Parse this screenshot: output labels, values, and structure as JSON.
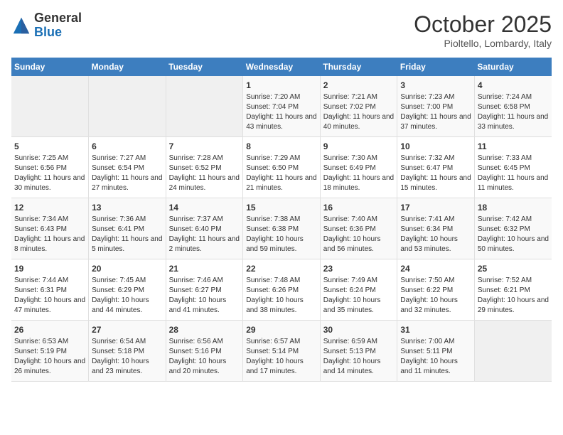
{
  "header": {
    "logo_general": "General",
    "logo_blue": "Blue",
    "month": "October 2025",
    "location": "Pioltello, Lombardy, Italy"
  },
  "days_of_week": [
    "Sunday",
    "Monday",
    "Tuesday",
    "Wednesday",
    "Thursday",
    "Friday",
    "Saturday"
  ],
  "weeks": [
    [
      {
        "day": "",
        "info": ""
      },
      {
        "day": "",
        "info": ""
      },
      {
        "day": "",
        "info": ""
      },
      {
        "day": "1",
        "info": "Sunrise: 7:20 AM\nSunset: 7:04 PM\nDaylight: 11 hours and 43 minutes."
      },
      {
        "day": "2",
        "info": "Sunrise: 7:21 AM\nSunset: 7:02 PM\nDaylight: 11 hours and 40 minutes."
      },
      {
        "day": "3",
        "info": "Sunrise: 7:23 AM\nSunset: 7:00 PM\nDaylight: 11 hours and 37 minutes."
      },
      {
        "day": "4",
        "info": "Sunrise: 7:24 AM\nSunset: 6:58 PM\nDaylight: 11 hours and 33 minutes."
      }
    ],
    [
      {
        "day": "5",
        "info": "Sunrise: 7:25 AM\nSunset: 6:56 PM\nDaylight: 11 hours and 30 minutes."
      },
      {
        "day": "6",
        "info": "Sunrise: 7:27 AM\nSunset: 6:54 PM\nDaylight: 11 hours and 27 minutes."
      },
      {
        "day": "7",
        "info": "Sunrise: 7:28 AM\nSunset: 6:52 PM\nDaylight: 11 hours and 24 minutes."
      },
      {
        "day": "8",
        "info": "Sunrise: 7:29 AM\nSunset: 6:50 PM\nDaylight: 11 hours and 21 minutes."
      },
      {
        "day": "9",
        "info": "Sunrise: 7:30 AM\nSunset: 6:49 PM\nDaylight: 11 hours and 18 minutes."
      },
      {
        "day": "10",
        "info": "Sunrise: 7:32 AM\nSunset: 6:47 PM\nDaylight: 11 hours and 15 minutes."
      },
      {
        "day": "11",
        "info": "Sunrise: 7:33 AM\nSunset: 6:45 PM\nDaylight: 11 hours and 11 minutes."
      }
    ],
    [
      {
        "day": "12",
        "info": "Sunrise: 7:34 AM\nSunset: 6:43 PM\nDaylight: 11 hours and 8 minutes."
      },
      {
        "day": "13",
        "info": "Sunrise: 7:36 AM\nSunset: 6:41 PM\nDaylight: 11 hours and 5 minutes."
      },
      {
        "day": "14",
        "info": "Sunrise: 7:37 AM\nSunset: 6:40 PM\nDaylight: 11 hours and 2 minutes."
      },
      {
        "day": "15",
        "info": "Sunrise: 7:38 AM\nSunset: 6:38 PM\nDaylight: 10 hours and 59 minutes."
      },
      {
        "day": "16",
        "info": "Sunrise: 7:40 AM\nSunset: 6:36 PM\nDaylight: 10 hours and 56 minutes."
      },
      {
        "day": "17",
        "info": "Sunrise: 7:41 AM\nSunset: 6:34 PM\nDaylight: 10 hours and 53 minutes."
      },
      {
        "day": "18",
        "info": "Sunrise: 7:42 AM\nSunset: 6:32 PM\nDaylight: 10 hours and 50 minutes."
      }
    ],
    [
      {
        "day": "19",
        "info": "Sunrise: 7:44 AM\nSunset: 6:31 PM\nDaylight: 10 hours and 47 minutes."
      },
      {
        "day": "20",
        "info": "Sunrise: 7:45 AM\nSunset: 6:29 PM\nDaylight: 10 hours and 44 minutes."
      },
      {
        "day": "21",
        "info": "Sunrise: 7:46 AM\nSunset: 6:27 PM\nDaylight: 10 hours and 41 minutes."
      },
      {
        "day": "22",
        "info": "Sunrise: 7:48 AM\nSunset: 6:26 PM\nDaylight: 10 hours and 38 minutes."
      },
      {
        "day": "23",
        "info": "Sunrise: 7:49 AM\nSunset: 6:24 PM\nDaylight: 10 hours and 35 minutes."
      },
      {
        "day": "24",
        "info": "Sunrise: 7:50 AM\nSunset: 6:22 PM\nDaylight: 10 hours and 32 minutes."
      },
      {
        "day": "25",
        "info": "Sunrise: 7:52 AM\nSunset: 6:21 PM\nDaylight: 10 hours and 29 minutes."
      }
    ],
    [
      {
        "day": "26",
        "info": "Sunrise: 6:53 AM\nSunset: 5:19 PM\nDaylight: 10 hours and 26 minutes."
      },
      {
        "day": "27",
        "info": "Sunrise: 6:54 AM\nSunset: 5:18 PM\nDaylight: 10 hours and 23 minutes."
      },
      {
        "day": "28",
        "info": "Sunrise: 6:56 AM\nSunset: 5:16 PM\nDaylight: 10 hours and 20 minutes."
      },
      {
        "day": "29",
        "info": "Sunrise: 6:57 AM\nSunset: 5:14 PM\nDaylight: 10 hours and 17 minutes."
      },
      {
        "day": "30",
        "info": "Sunrise: 6:59 AM\nSunset: 5:13 PM\nDaylight: 10 hours and 14 minutes."
      },
      {
        "day": "31",
        "info": "Sunrise: 7:00 AM\nSunset: 5:11 PM\nDaylight: 10 hours and 11 minutes."
      },
      {
        "day": "",
        "info": ""
      }
    ]
  ]
}
